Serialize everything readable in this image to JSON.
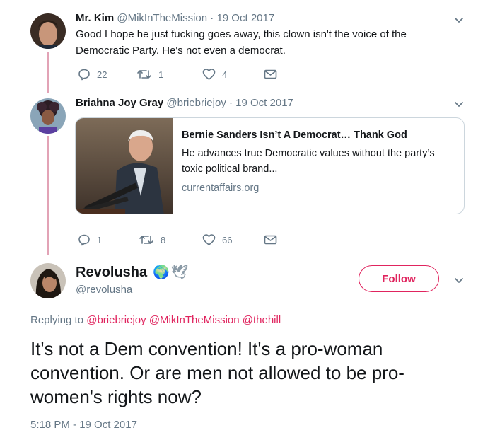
{
  "tweets": [
    {
      "name": "Mr. Kim",
      "handle": "@MikInTheMission",
      "date": "· 19 Oct 2017",
      "text": "Good I hope he just fucking goes away, this clown isn't the voice of the Democratic Party. He's not even a democrat.",
      "replies": "22",
      "retweets": "1",
      "likes": "4"
    },
    {
      "name": "Briahna Joy Gray",
      "handle": "@briebriejoy",
      "date": "· 19 Oct 2017",
      "card": {
        "title": "Bernie Sanders Isn’t A Democrat… Thank God",
        "description": "He advances true Democratic values without the party’s toxic political brand...",
        "domain": "currentaffairs.org"
      },
      "replies": "1",
      "retweets": "8",
      "likes": "66"
    }
  ],
  "main_tweet": {
    "name": "Revolusha",
    "emoji": [
      "🌍",
      "🕊"
    ],
    "handle": "@revolusha",
    "follow_label": "Follow",
    "replying_prefix": "Replying to",
    "mentions": [
      "@briebriejoy",
      "@MikInTheMission",
      "@thehill"
    ],
    "text": "It's not a Dem convention! It's a pro-woman convention. Or are men not allowed to be pro-women's rights now?",
    "timestamp": "5:18 PM - 19 Oct 2017"
  },
  "colors": {
    "accent": "#e0245e",
    "thread_line": "#e2a3b6",
    "secondary_text": "#657786",
    "border": "#ccd6dd"
  },
  "icons": [
    "reply-icon",
    "retweet-icon",
    "like-icon",
    "message-icon",
    "chevron-down-icon"
  ]
}
